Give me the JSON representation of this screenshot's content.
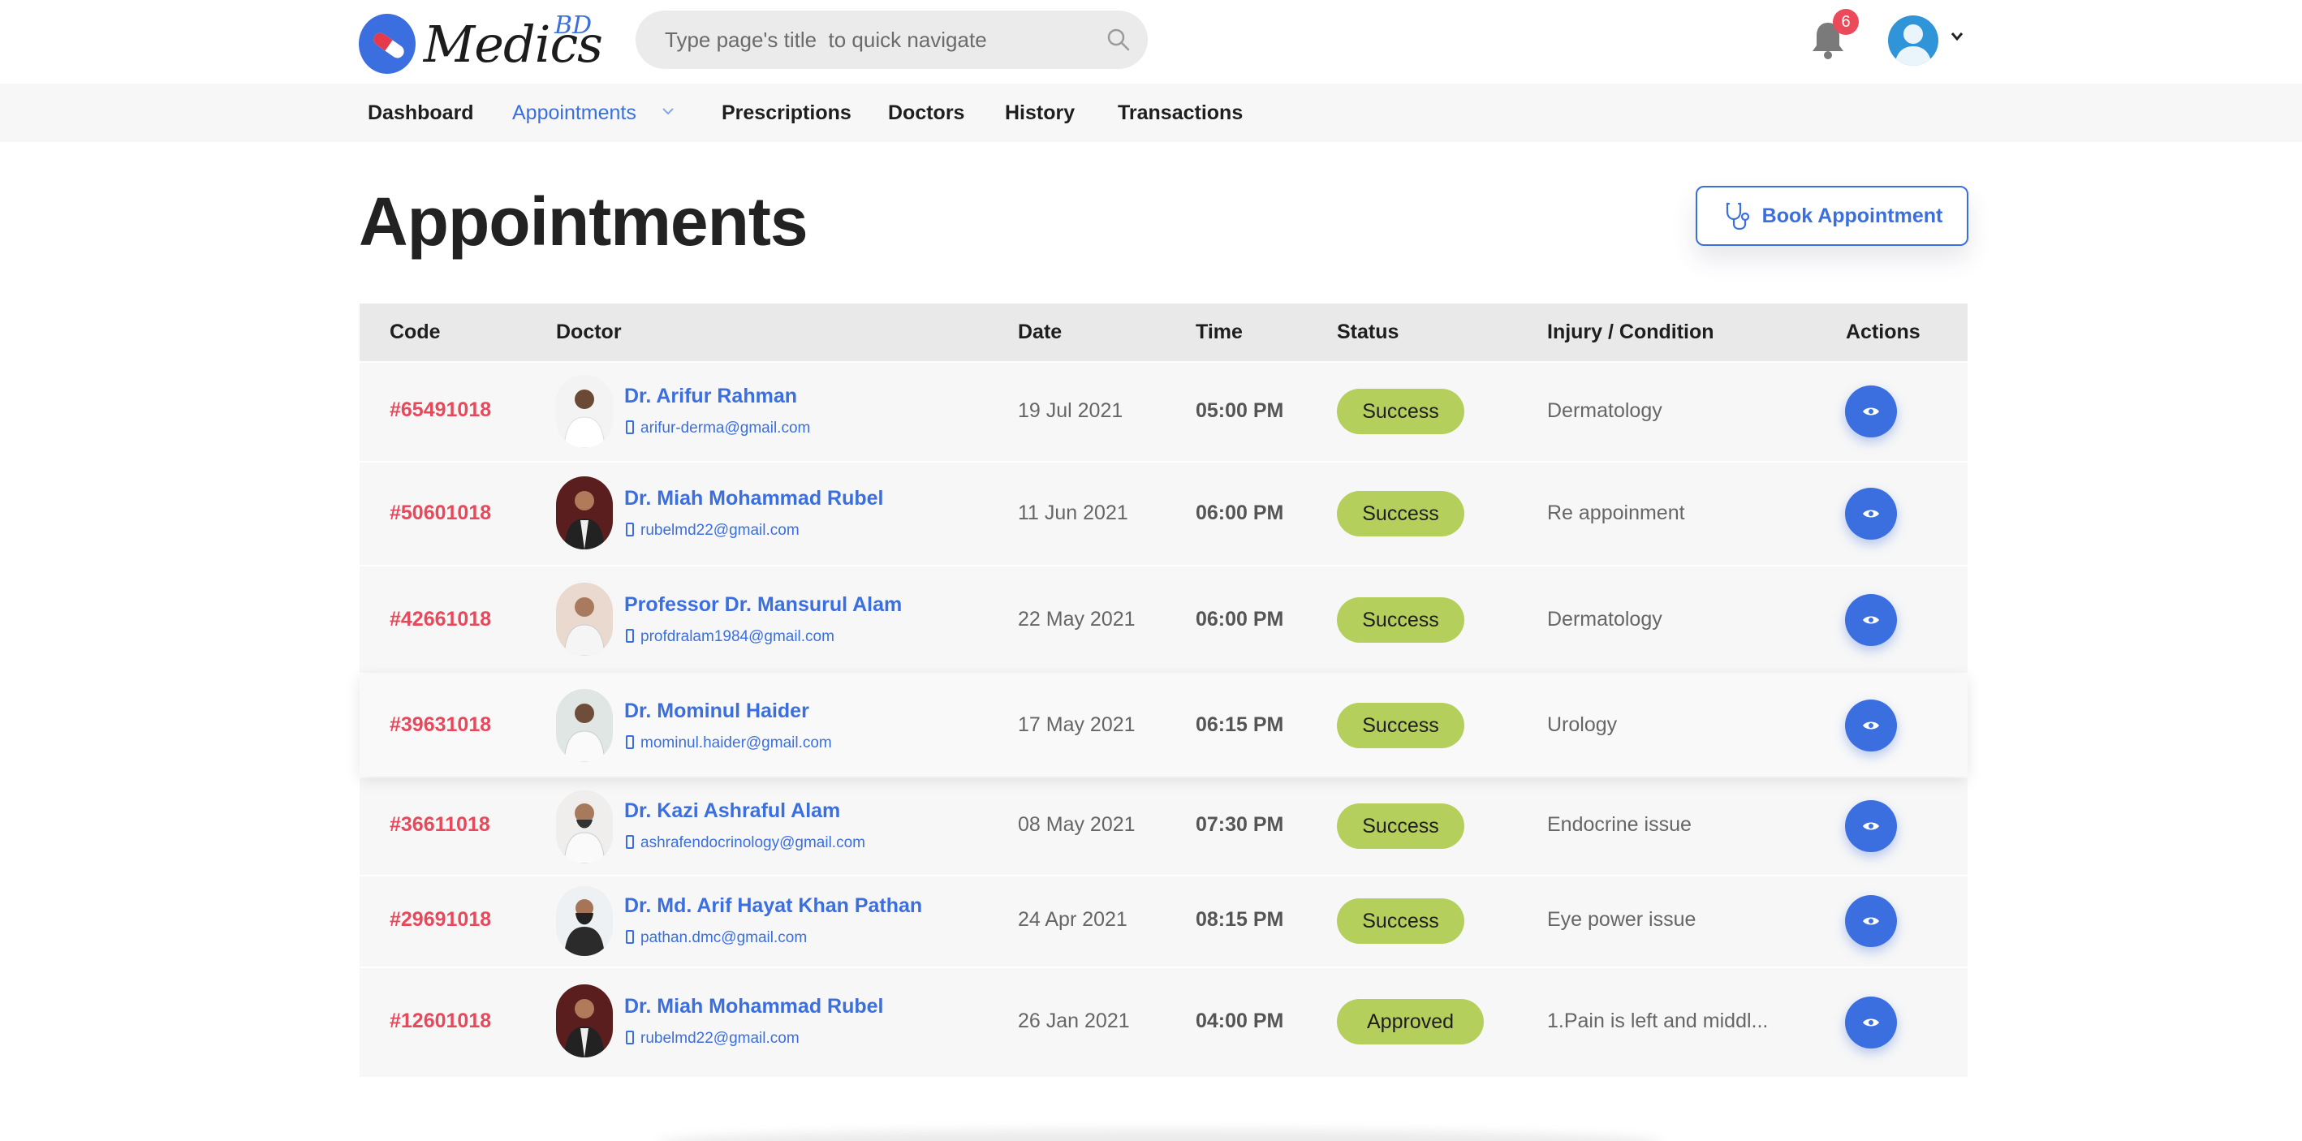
{
  "brand": {
    "name": "Medics",
    "superscript": "BD",
    "primary": "#3b6fe0",
    "accent_red": "#e8485a",
    "success_green": "#b5cf5c"
  },
  "search": {
    "placeholder": "Type page's title  to quick navigate",
    "value": ""
  },
  "notifications": {
    "count": "6"
  },
  "nav": {
    "items": [
      {
        "label": "Dashboard",
        "active": false
      },
      {
        "label": "Appointments",
        "active": true
      },
      {
        "label": "Prescriptions",
        "active": false
      },
      {
        "label": "Doctors",
        "active": false
      },
      {
        "label": "History",
        "active": false
      },
      {
        "label": "Transactions",
        "active": false
      }
    ]
  },
  "page": {
    "title": "Appointments",
    "book_button": "Book Appointment"
  },
  "table": {
    "columns": [
      "Code",
      "Doctor",
      "Date",
      "Time",
      "Status",
      "Injury / Condition",
      "Actions"
    ],
    "rows": [
      {
        "code": "#65491018",
        "doctor": "Dr. Arifur Rahman",
        "email": "arifur-derma@gmail.com",
        "date": "19 Jul 2021",
        "time": "05:00 PM",
        "status": "Success",
        "condition": "Dermatology"
      },
      {
        "code": "#50601018",
        "doctor": "Dr. Miah Mohammad Rubel",
        "email": "rubelmd22@gmail.com",
        "date": "11 Jun 2021",
        "time": "06:00 PM",
        "status": "Success",
        "condition": "Re appoinment"
      },
      {
        "code": "#42661018",
        "doctor": "Professor Dr. Mansurul Alam",
        "email": "profdralam1984@gmail.com",
        "date": "22 May 2021",
        "time": "06:00 PM",
        "status": "Success",
        "condition": "Dermatology"
      },
      {
        "code": "#39631018",
        "doctor": "Dr. Mominul Haider",
        "email": "mominul.haider@gmail.com",
        "date": "17 May 2021",
        "time": "06:15 PM",
        "status": "Success",
        "condition": "Urology"
      },
      {
        "code": "#36611018",
        "doctor": "Dr. Kazi Ashraful Alam",
        "email": "ashrafendocrinology@gmail.com",
        "date": "08 May 2021",
        "time": "07:30 PM",
        "status": "Success",
        "condition": "Endocrine issue"
      },
      {
        "code": "#29691018",
        "doctor": "Dr. Md. Arif Hayat Khan Pathan",
        "email": "pathan.dmc@gmail.com",
        "date": "24 Apr 2021",
        "time": "08:15 PM",
        "status": "Success",
        "condition": "Eye power issue"
      },
      {
        "code": "#12601018",
        "doctor": "Dr. Miah Mohammad Rubel",
        "email": "rubelmd22@gmail.com",
        "date": "26 Jan 2021",
        "time": "04:00 PM",
        "status": "Approved",
        "condition": "1.Pain is left and middl..."
      }
    ]
  }
}
